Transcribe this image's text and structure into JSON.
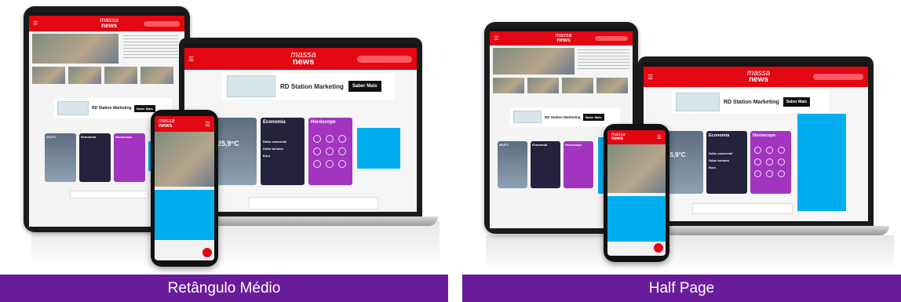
{
  "panels": [
    {
      "caption": "Retângulo Médio"
    },
    {
      "caption": "Half Page"
    }
  ],
  "site": {
    "logo_top": "massa",
    "logo_bottom": "news"
  },
  "ad": {
    "headline": "RD Station Marketing",
    "cta": "Saber Mais",
    "brand": "RD Station"
  },
  "widgets": {
    "economy_title": "Economia",
    "horoscope_title": "Horóscopo",
    "temperature": "25,9°C",
    "dollar_commercial": "Dólar comercial",
    "dollar_tourism": "Dólar turismo",
    "euro": "Euro"
  },
  "colors": {
    "brand_red": "#e30613",
    "caption_purple": "#6a1b9a",
    "ad_cyan": "#00aeef",
    "horoscope_purple": "#a234c0",
    "economy_navy": "#24223c"
  },
  "icons": [
    "menu-icon",
    "search-icon",
    "camera-icon",
    "plus-icon",
    "zodiac-icon"
  ]
}
